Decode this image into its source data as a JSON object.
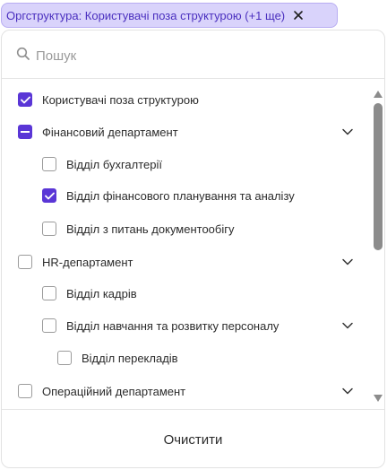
{
  "chip": {
    "label": "Оргструктура: Користувачі поза структурою (+1 ще)",
    "close_icon": "close-icon"
  },
  "search": {
    "placeholder": "Пошук",
    "value": ""
  },
  "tree": [
    {
      "label": "Користувачі поза структурою",
      "state": "checked"
    },
    {
      "label": "Фінансовий департамент",
      "state": "indeterminate",
      "expandable": true
    },
    {
      "label": "Відділ бухгалтерії",
      "state": "unchecked"
    },
    {
      "label": "Відділ фінансового планування та аналізу",
      "state": "checked"
    },
    {
      "label": "Відділ з питань документообігу",
      "state": "unchecked"
    },
    {
      "label": "HR-департамент",
      "state": "unchecked",
      "expandable": true
    },
    {
      "label": "Відділ кадрів",
      "state": "unchecked"
    },
    {
      "label": "Відділ навчання та розвитку персоналу",
      "state": "unchecked",
      "expandable": true
    },
    {
      "label": "Відділ перекладів",
      "state": "unchecked"
    },
    {
      "label": "Операційний департамент",
      "state": "unchecked",
      "expandable": true
    }
  ],
  "footer": {
    "clear_label": "Очистити"
  },
  "colors": {
    "accent": "#5a36d6",
    "chip_bg": "#d9d3fb",
    "chip_text": "#4a2fbf"
  }
}
